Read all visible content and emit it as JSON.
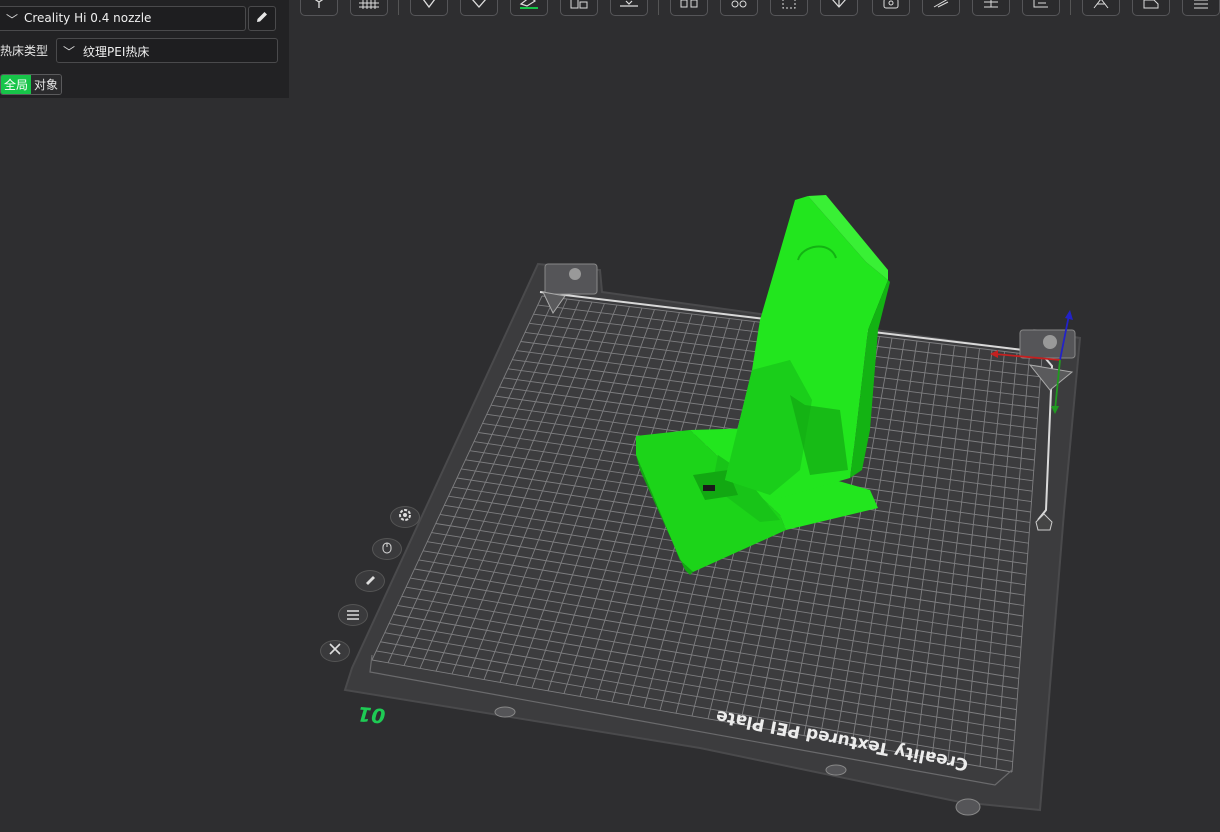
{
  "printer": {
    "name": "Creality Hi 0.4 nozzle",
    "edit_icon": "pencil-icon"
  },
  "bed": {
    "label": "热床类型",
    "value": "纹理PEI热床"
  },
  "scope": {
    "global": "全局",
    "object": "对象"
  },
  "toolbar": {
    "icons": [
      "cube-view-icon",
      "grid-icon",
      "add-shape-icon",
      "support-paint-icon",
      "seam-paint-icon",
      "arrange-icon",
      "lay-flat-icon",
      "split-objects-icon",
      "settings-icon",
      "measure-icon",
      "cut-icon",
      "emboss-icon",
      "fuzzy-skin-icon",
      "variable-layer-icon",
      "assembly-icon",
      "text-icon",
      "hollow-icon",
      "more-icon"
    ]
  },
  "side_tools": [
    "gear-icon",
    "mouse-icon",
    "auto-orient-icon",
    "list-icon",
    "close-icon"
  ],
  "plate": {
    "label": "Creality Textured PEI Plate",
    "number": "01",
    "colors": {
      "plate": "#3c3c3e",
      "grid_line": "#7e7e80",
      "model": "#22e61e",
      "model_shade": "#13b313",
      "plate_number": "#1ecb54"
    }
  }
}
